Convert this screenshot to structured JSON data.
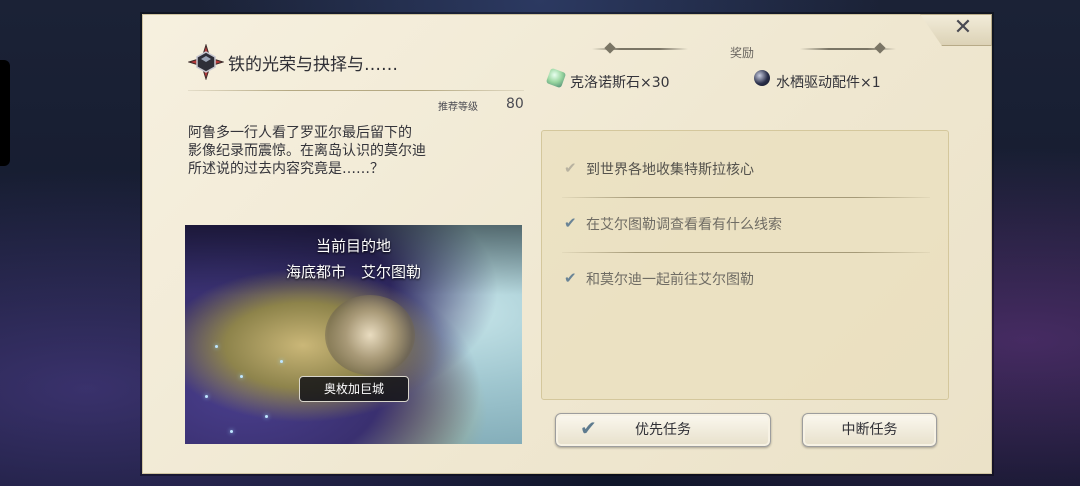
{
  "quest": {
    "title": "铁的光荣与抉择与……",
    "level_label": "推荐等级",
    "level_value": "80",
    "description": "阿鲁多一行人看了罗亚尔最后留下的\n影像纪录而震惊。在离岛认识的莫尔迪\n所述说的过去内容究竟是……？"
  },
  "map": {
    "destination_label": "当前目的地",
    "destination_name": "海底都市　艾尔图勒",
    "place_tag": "奥枚加巨城"
  },
  "rewards": {
    "header": "奖励",
    "items": [
      {
        "label": "克洛诺斯石×30",
        "icon": "chronos-stone-icon",
        "color": "#9ad6a0"
      },
      {
        "label": "水栖驱动配件×1",
        "icon": "aquatic-drive-part-icon",
        "color": "#2a2f4a"
      }
    ]
  },
  "objectives": [
    {
      "label": "到世界各地收集特斯拉核心",
      "checked": true,
      "faded": true
    },
    {
      "label": "在艾尔图勒调查看看有什么线索",
      "checked": true,
      "faded": false
    },
    {
      "label": "和莫尔迪一起前往艾尔图勒",
      "checked": true,
      "faded": false
    }
  ],
  "buttons": {
    "priority": "优先任务",
    "abort": "中断任务"
  },
  "colors": {
    "panel": "#f2ead5",
    "objective_box": "#e9dfbe",
    "check": "#6a8496"
  }
}
